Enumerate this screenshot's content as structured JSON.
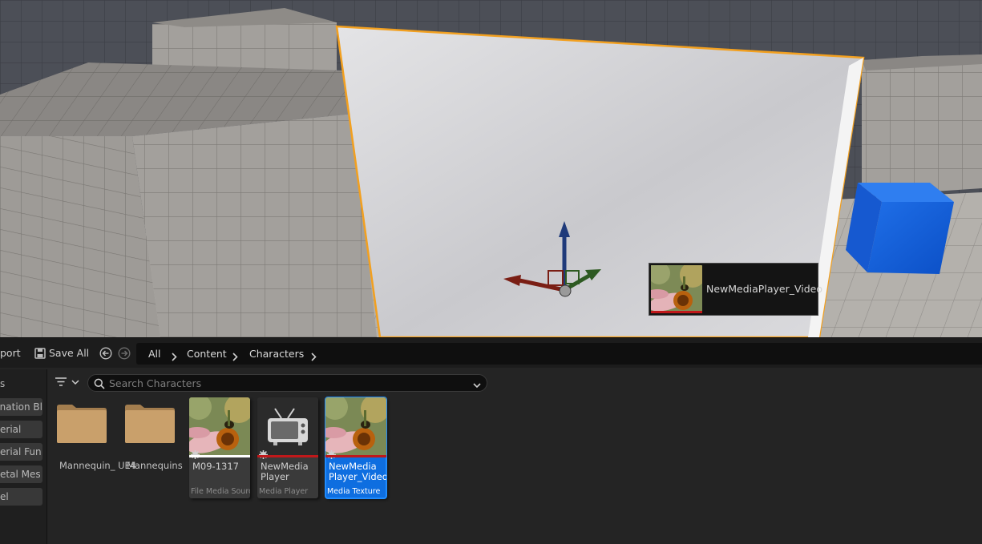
{
  "viewport": {
    "drag_tooltip": {
      "label": "NewMediaPlayer_Video"
    }
  },
  "toolbar": {
    "import_label": "port",
    "save_all_label": "Save All"
  },
  "breadcrumb": [
    "All",
    "Content",
    "Characters"
  ],
  "sidebar": {
    "header_fragment": "s",
    "items": [
      "nation Bl",
      "erial",
      "erial Fun",
      "etal Mes",
      "el"
    ]
  },
  "search": {
    "placeholder": "Search Characters",
    "value": ""
  },
  "assets": {
    "folders": [
      {
        "name": "Mannequin_\nUE4"
      },
      {
        "name": "Mannequins"
      }
    ],
    "items": [
      {
        "name": "M09-1317",
        "type": "File Media Source",
        "stripe_color": "#ffffff",
        "icon": "flower-thumbnail",
        "selected": false
      },
      {
        "name": "NewMedia\nPlayer",
        "type": "Media Player",
        "stripe_color": "#c0181a",
        "icon": "tv-icon",
        "selected": false
      },
      {
        "name": "NewMedia\nPlayer_Video",
        "type": "Media Texture",
        "stripe_color": "#c0181a",
        "icon": "flower-thumbnail",
        "selected": true
      }
    ]
  },
  "colors": {
    "selection_blue": "#0e6ee0",
    "selection_outline": "#f2a020",
    "media_red": "#c0181a"
  }
}
